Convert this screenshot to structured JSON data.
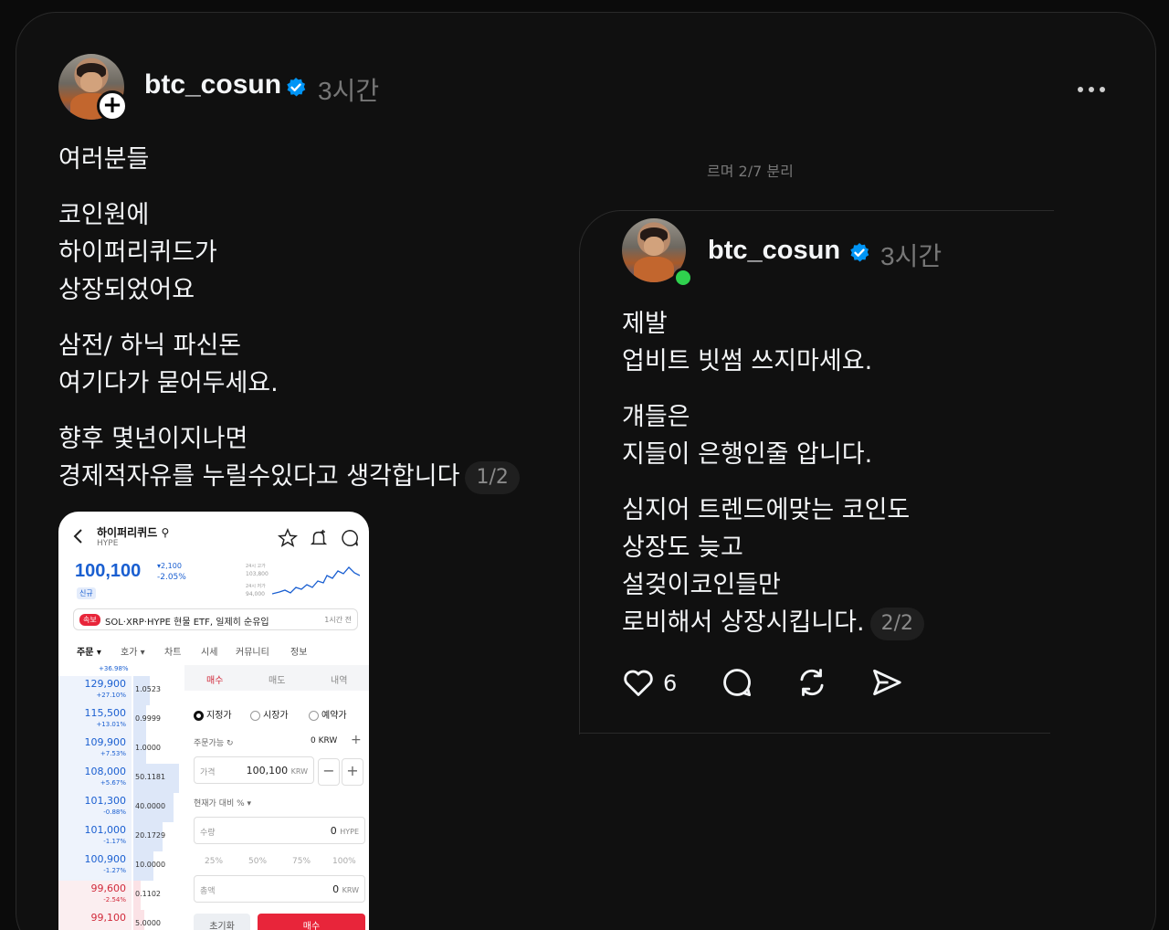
{
  "post": {
    "username": "btc_cosun",
    "time": "3시간",
    "paragraphs": [
      [
        "여러분들"
      ],
      [
        "코인원에",
        "하이퍼리퀴드가",
        "상장되었어요"
      ],
      [
        "삼전/ 하닉 파신돈",
        "여기다가 묻어두세요."
      ],
      [
        "향후 몇년이지나면",
        "경제적자유를 누릴수있다고 생각합니다"
      ]
    ],
    "pager": "1/2",
    "screenshot": {
      "coin_name": "하이퍼리퀴드",
      "ticker": "HYPE",
      "price": "100,100",
      "change_abs": "▾2,100",
      "change_pct": "-2.05%",
      "new_badge": "신규",
      "mini_high_label": "24시 고가",
      "mini_high": "103,800",
      "mini_low_label": "24시 저가",
      "mini_low": "94,000",
      "news_tag": "속보",
      "news": "SOL·XRP·HYPE 현물 ETF, 일제히 순유입",
      "news_ago": "1시간 전",
      "tabs": [
        "주문 ▾",
        "호가 ▾",
        "차트",
        "시세",
        "커뮤니티",
        "정보"
      ],
      "book_top_change": "+36.98%",
      "book": [
        {
          "price": "129,900",
          "change": "+27.10%",
          "qty": "1.0523"
        },
        {
          "price": "115,500",
          "change": "+13.01%",
          "qty": "0.9999"
        },
        {
          "price": "109,900",
          "change": "+7.53%",
          "qty": "1.0000"
        },
        {
          "price": "108,000",
          "change": "+5.67%",
          "qty": "50.1181"
        },
        {
          "price": "101,300",
          "change": "-0.88%",
          "qty": "40.0000"
        },
        {
          "price": "101,000",
          "change": "-1.17%",
          "qty": "20.1729"
        },
        {
          "price": "100,900",
          "change": "-1.27%",
          "qty": "10.0000"
        },
        {
          "price": "99,600",
          "change": "-2.54%",
          "qty": "0.1102"
        },
        {
          "price": "99,100",
          "change": "",
          "qty": "5.0000"
        }
      ],
      "order_tabs": [
        "매수",
        "매도",
        "내역"
      ],
      "order_types": [
        "지정가",
        "시장가",
        "예약가"
      ],
      "available_label": "주문가능 ↻",
      "available_value": "0 KRW",
      "price_label": "가격",
      "price_value": "100,100",
      "price_unit": "KRW",
      "vs_current": "현재가 대비 % ▾",
      "qty_label": "수량",
      "qty_value": "0",
      "qty_unit": "HYPE",
      "percents": [
        "25%",
        "50%",
        "75%",
        "100%"
      ],
      "total_label": "총액",
      "total_value": "0",
      "total_unit": "KRW",
      "reset_label": "초기화",
      "buy_label": "매수"
    }
  },
  "reply": {
    "username": "btc_cosun",
    "time": "3시간",
    "paragraphs": [
      [
        "제발",
        "업비트 빗썸 쓰지마세요."
      ],
      [
        "걔들은",
        "지들이 은행인줄 압니다."
      ],
      [
        "심지어 트렌드에맞는 코인도",
        "상장도 늦고",
        "설겆이코인들만",
        "로비해서 상장시킵니다."
      ]
    ],
    "pager": "2/2",
    "like_count": "6",
    "cut_text": "르며 2/7 분리"
  },
  "colors": {
    "background": "#101010",
    "text": "#f3f5f7",
    "muted": "#777777",
    "verified": "#0095f6",
    "online": "#2fd14e"
  },
  "icons": [
    "plus-icon",
    "verified-badge-icon",
    "more-icon",
    "heart-icon",
    "comment-icon",
    "repost-icon",
    "share-icon"
  ]
}
